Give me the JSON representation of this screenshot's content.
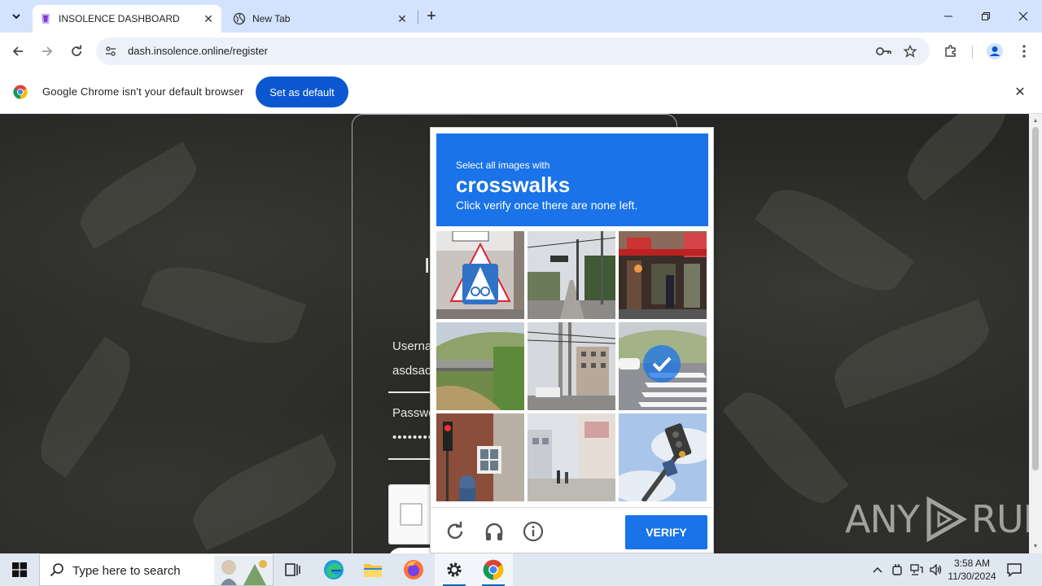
{
  "browser": {
    "tabs": [
      {
        "title": "INSOLENCE DASHBOARD",
        "active": true
      },
      {
        "title": "New Tab",
        "active": false
      }
    ],
    "url": "dash.insolence.online/register",
    "infobar": {
      "message": "Google Chrome isn't your default browser",
      "button": "Set as default"
    }
  },
  "login_form": {
    "heading": "I",
    "username_label": "Userna",
    "username_value": "asdsac",
    "password_label": "Passwo",
    "password_value": "••••••••"
  },
  "captcha": {
    "instruction": "Select all images with",
    "target": "crosswalks",
    "hint": "Click verify once there are none left.",
    "verify_label": "VERIFY",
    "accent": "#1a73e8",
    "tiles": [
      {
        "name": "tile-bicycle-sign",
        "selected": false
      },
      {
        "name": "tile-street-traffic-light",
        "selected": false
      },
      {
        "name": "tile-storefront",
        "selected": false
      },
      {
        "name": "tile-bridge-hillside",
        "selected": false
      },
      {
        "name": "tile-utility-poles",
        "selected": false
      },
      {
        "name": "tile-crosswalk",
        "selected": true
      },
      {
        "name": "tile-brick-building-signal",
        "selected": false
      },
      {
        "name": "tile-shopping-street",
        "selected": false
      },
      {
        "name": "tile-traffic-signal-sky",
        "selected": false
      }
    ]
  },
  "watermark": {
    "left": "ANY",
    "right": "RUN"
  },
  "taskbar": {
    "search_placeholder": "Type here to search",
    "time": "3:58 AM",
    "date": "11/30/2024"
  }
}
